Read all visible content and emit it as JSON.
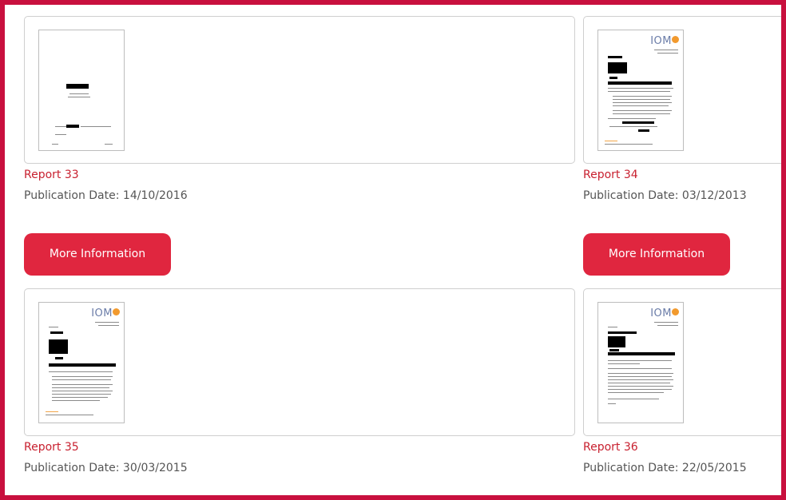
{
  "reports": [
    {
      "title": "Report 33",
      "date_text": "Publication Date: 14/10/2016",
      "button_label": "More Information"
    },
    {
      "title": "Report 34",
      "date_text": "Publication Date: 03/12/2013",
      "button_label": "More Information"
    },
    {
      "title": "Report 35",
      "date_text": "Publication Date: 30/03/2015"
    },
    {
      "title": "Report 36",
      "date_text": "Publication Date: 22/05/2015"
    }
  ],
  "logo_text": "IOM",
  "colors": {
    "frame": "#c8103e",
    "link": "#c8202f",
    "button": "#e0263f",
    "text": "#555555"
  }
}
